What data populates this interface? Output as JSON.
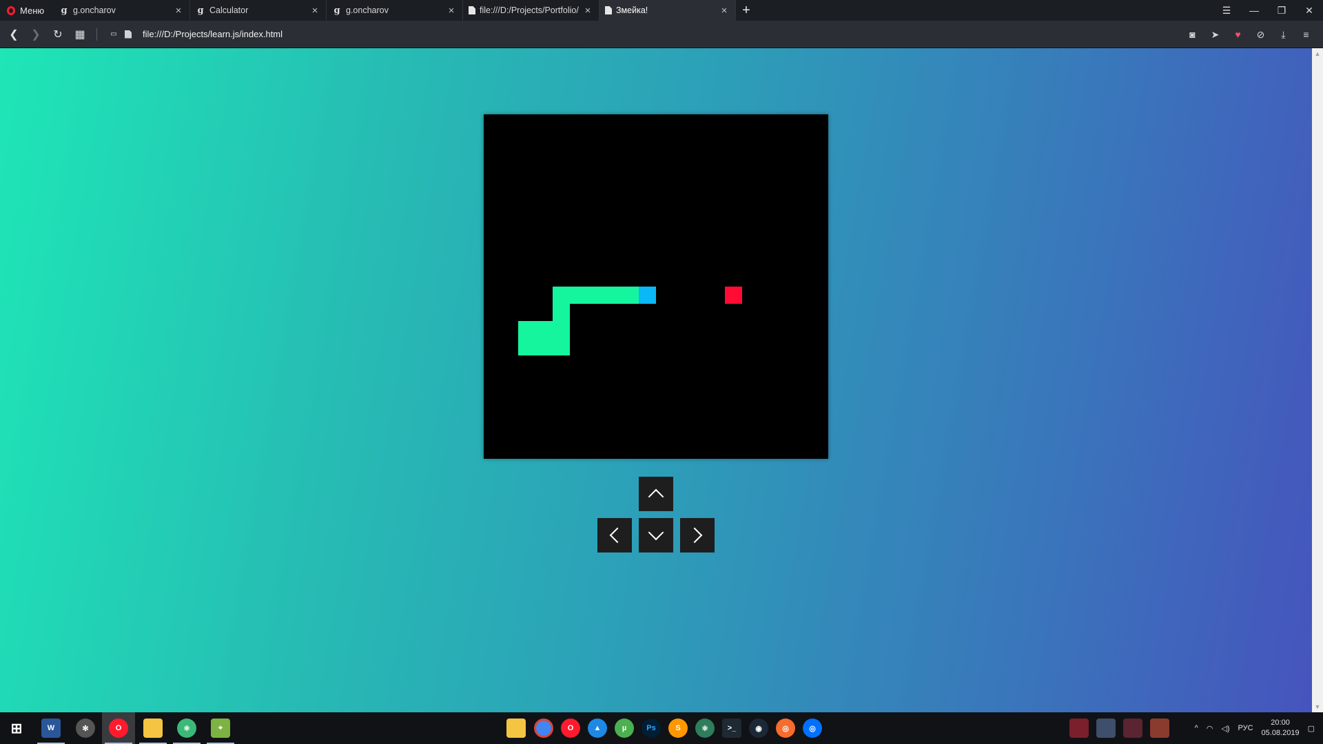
{
  "browser": {
    "menu_label": "Меню",
    "tabs": [
      {
        "title": "g.oncharov",
        "icon": "g"
      },
      {
        "title": "Calculator",
        "icon": "g"
      },
      {
        "title": "g.oncharov",
        "icon": "g"
      },
      {
        "title": "file:///D:/Projects/Portfolio/",
        "icon": "doc"
      },
      {
        "title": "Змейка!",
        "icon": "doc"
      }
    ],
    "url": "file:///D:/Projects/learn.js/index.html"
  },
  "game": {
    "board_cells": 20,
    "snake_body": [
      [
        2,
        13
      ],
      [
        3,
        13
      ],
      [
        4,
        13
      ],
      [
        4,
        12
      ],
      [
        3,
        12
      ],
      [
        2,
        12
      ],
      [
        4,
        11
      ],
      [
        4,
        10
      ],
      [
        5,
        10
      ],
      [
        6,
        10
      ],
      [
        7,
        10
      ],
      [
        8,
        10
      ]
    ],
    "snake_head": [
      9,
      10
    ],
    "food": [
      14,
      10
    ],
    "colors": {
      "board": "#000000",
      "snake": "#15f59e",
      "head": "#0ab8f5",
      "food": "#ff0b34"
    }
  },
  "controls": [
    "up",
    "left",
    "down",
    "right"
  ],
  "taskbar": {
    "language": "РУС",
    "time": "20:00",
    "date": "05.08.2019"
  }
}
